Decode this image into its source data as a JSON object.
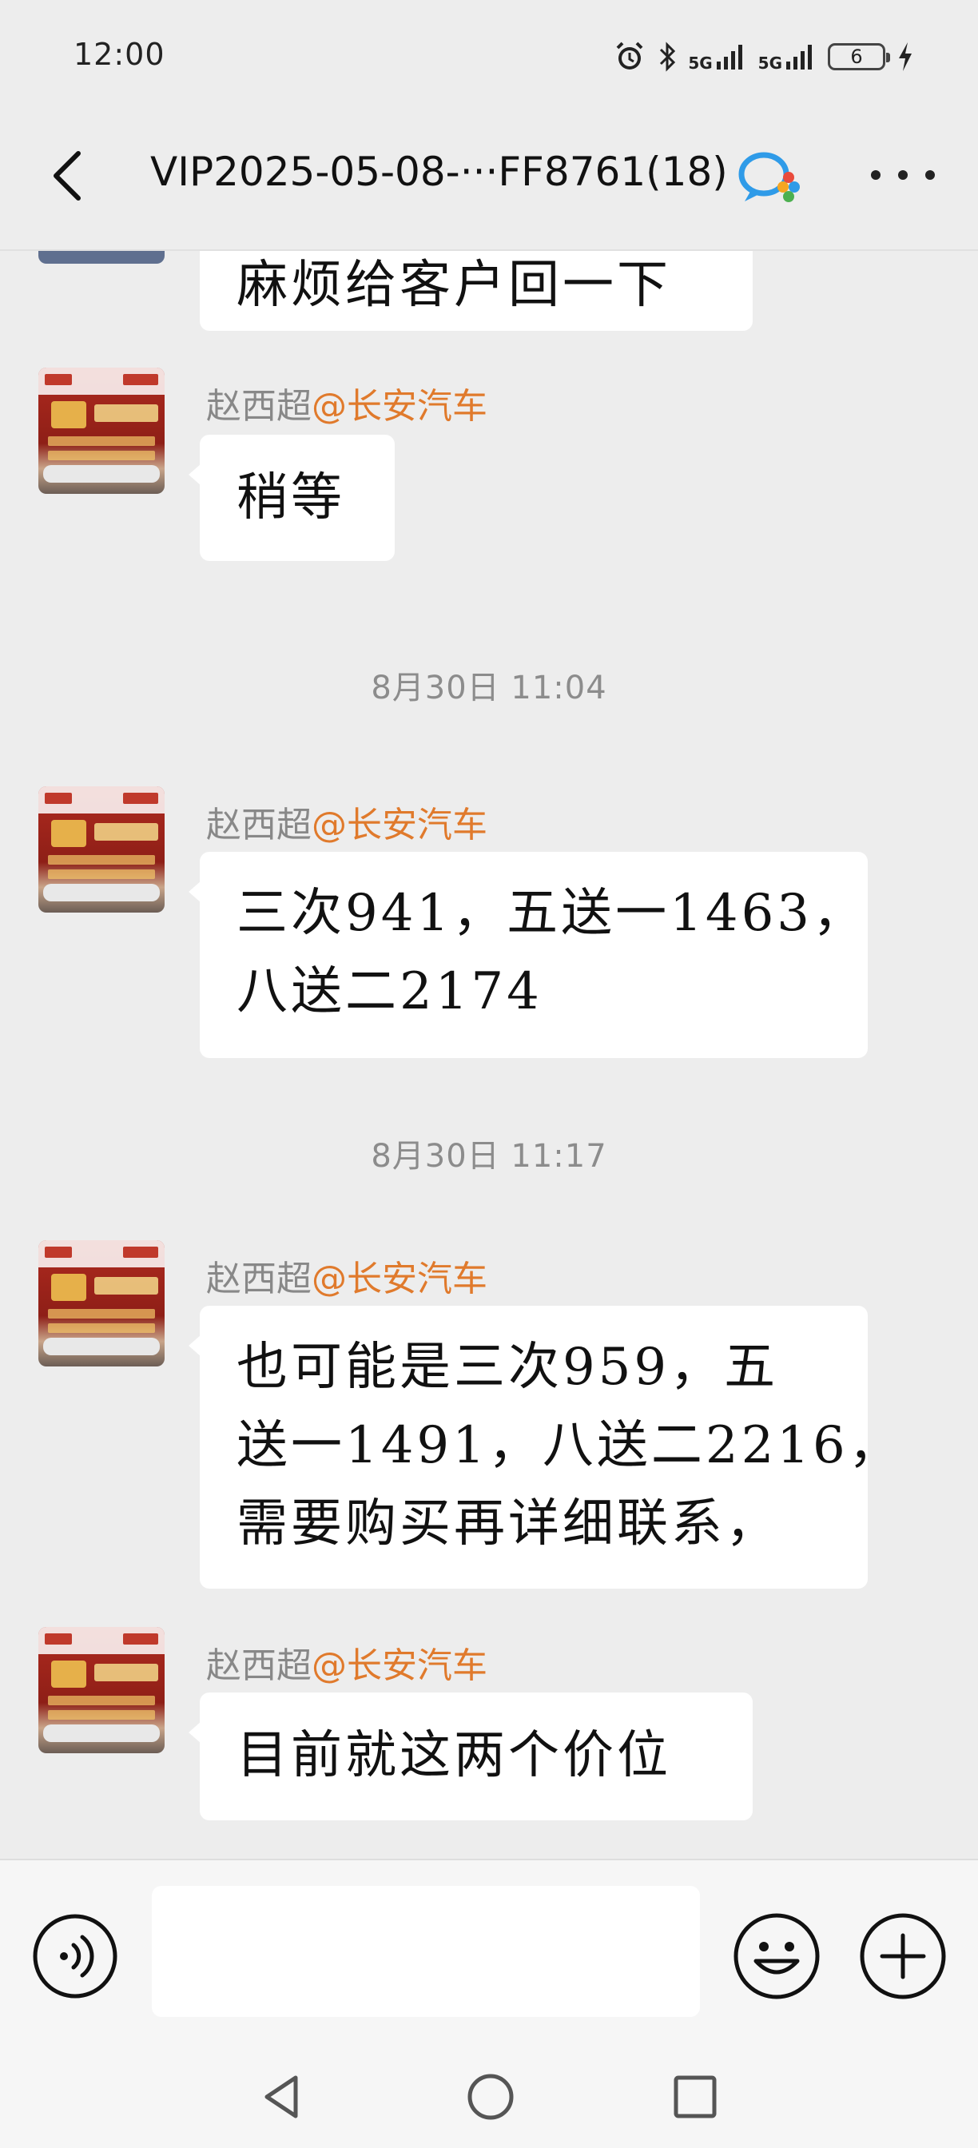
{
  "status_bar": {
    "time": "12:00",
    "network_1": "5G",
    "network_2": "5G",
    "battery_level": "6",
    "icons": [
      "alarm-icon",
      "bluetooth-icon",
      "signal-icon",
      "signal-icon",
      "battery-icon",
      "charging-icon"
    ]
  },
  "header": {
    "title": "VIP2025-05-08-···FF8761(18)",
    "back_icon": "chevron-left-icon",
    "app_icon": "wecom-chat-icon",
    "more_icon": "more-dots-icon"
  },
  "messages": [
    {
      "type": "message",
      "partial": true,
      "lines": [
        "麻烦给客户回一下"
      ]
    },
    {
      "type": "message",
      "sender_name": "赵西超",
      "sender_corp": "@长安汽车",
      "lines": [
        "稍等"
      ]
    },
    {
      "type": "time",
      "text": "8月30日 11:04"
    },
    {
      "type": "message",
      "sender_name": "赵西超",
      "sender_corp": "@长安汽车",
      "lines": [
        "三次941，五送一1463，",
        "八送二2174"
      ]
    },
    {
      "type": "time",
      "text": "8月30日 11:17"
    },
    {
      "type": "message",
      "sender_name": "赵西超",
      "sender_corp": "@长安汽车",
      "lines": [
        "也可能是三次959，五",
        "送一1491，八送二2216，",
        "需要购买再详细联系，"
      ]
    },
    {
      "type": "message",
      "sender_name": "赵西超",
      "sender_corp": "@长安汽车",
      "lines": [
        "目前就这两个价位"
      ]
    }
  ],
  "input_bar": {
    "voice_icon": "voice-icon",
    "emoji_icon": "emoji-icon",
    "plus_icon": "plus-icon",
    "input_value": ""
  },
  "nav_bar": {
    "back_icon": "nav-back-icon",
    "home_icon": "nav-home-icon",
    "recent_icon": "nav-recent-icon"
  }
}
